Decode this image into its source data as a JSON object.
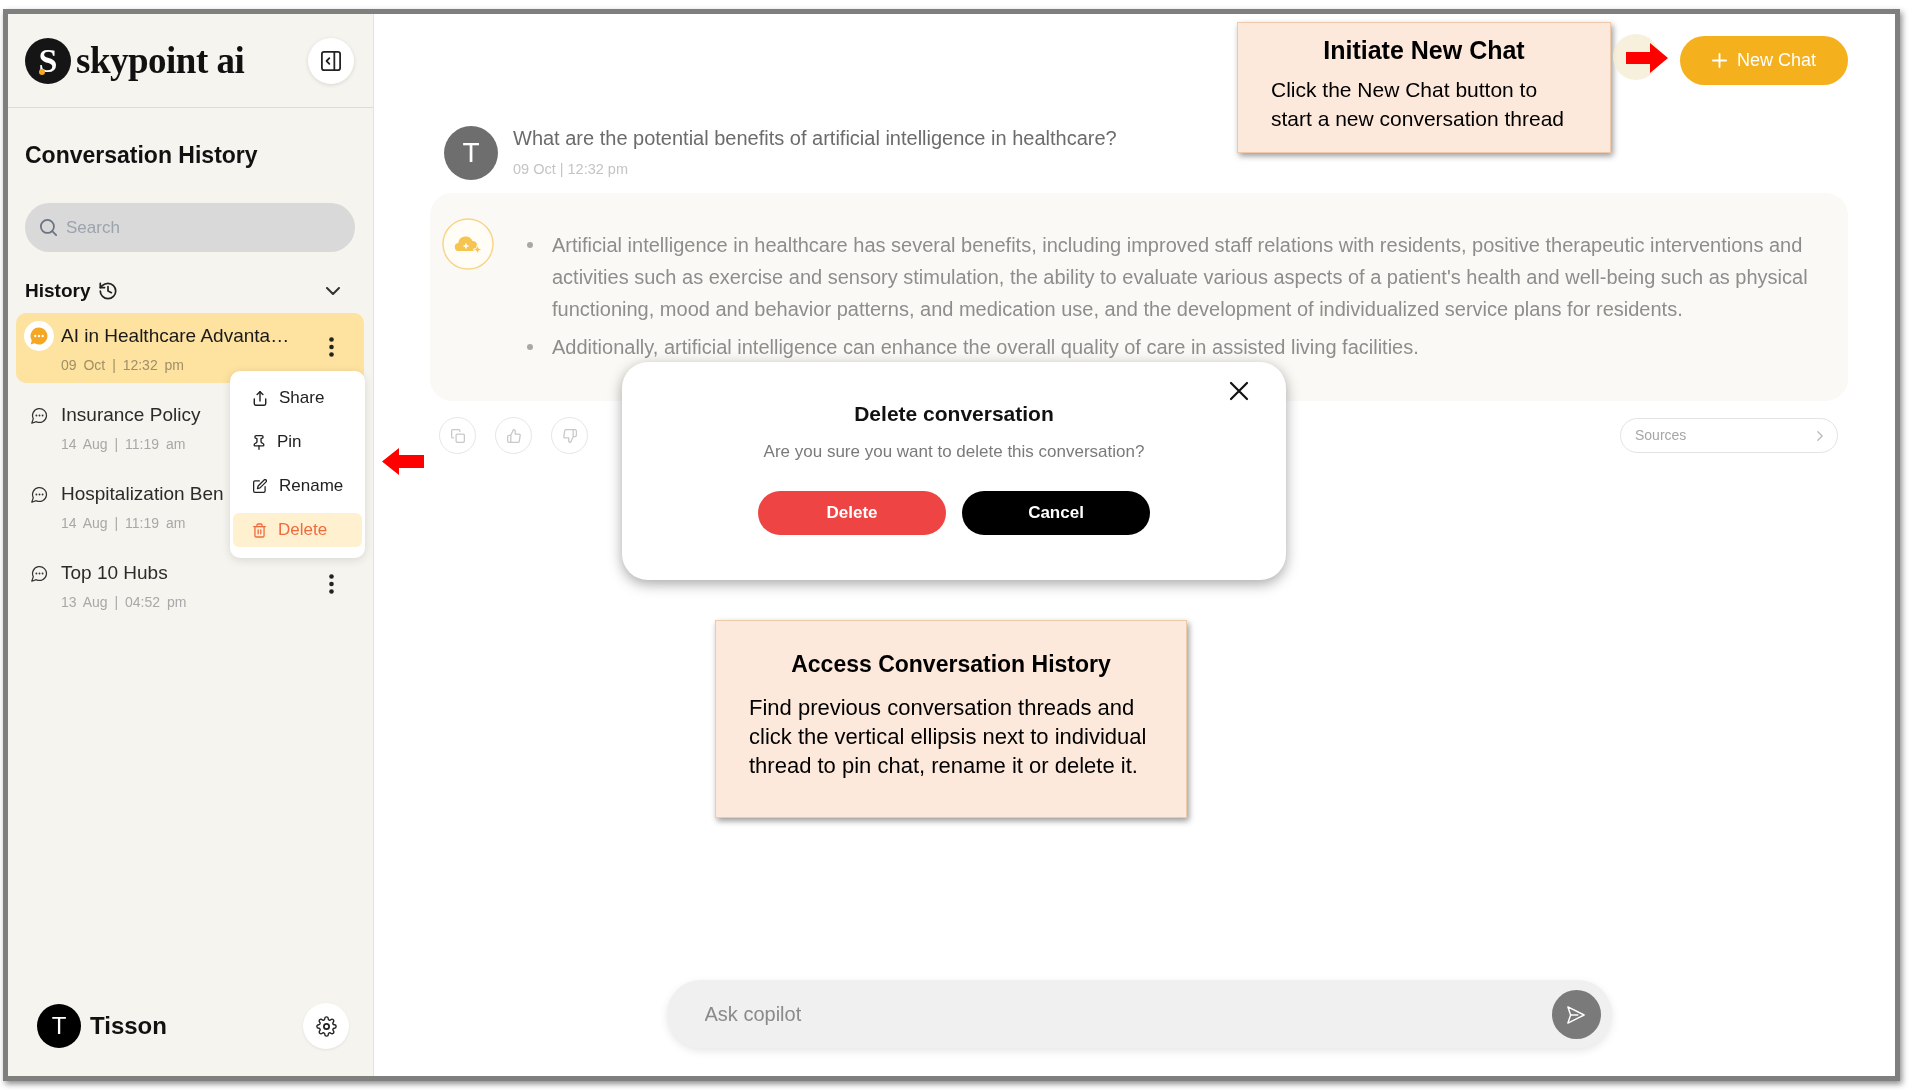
{
  "sidebar": {
    "logo": {
      "mark": "S",
      "text": "skypoint ai"
    },
    "title": "Conversation History",
    "search": {
      "placeholder": "Search"
    },
    "history": {
      "label": "History",
      "expanded": true
    },
    "conversations": [
      {
        "title": "AI in Healthcare Advanta…",
        "time": "09 Oct | 12:32 pm",
        "selected": true,
        "menu_button": true
      },
      {
        "title": "Insurance Policy",
        "time": "14 Aug | 11:19 am",
        "selected": false,
        "menu_button": false
      },
      {
        "title": "Hospitalization Ben",
        "time": "14 Aug | 11:19 am",
        "selected": false,
        "menu_button": false
      },
      {
        "title": "Top 10 Hubs",
        "time": "13 Aug | 04:52 pm",
        "selected": false,
        "menu_button": true
      }
    ],
    "context_menu": [
      {
        "label": "Share",
        "selected": false
      },
      {
        "label": "Pin",
        "selected": false
      },
      {
        "label": "Rename",
        "selected": false
      },
      {
        "label": "Delete",
        "selected": true
      }
    ],
    "user": {
      "initial": "T",
      "name": "Tisson"
    }
  },
  "header": {
    "new_chat_button": "New Chat"
  },
  "conversation": {
    "question": {
      "avatar": "T",
      "text": "What are the potential benefits of artificial intelligence in healthcare?",
      "time": "09 Oct | 12:32 pm"
    },
    "answer": {
      "bullets": [
        "Artificial intelligence in healthcare has several benefits, including improved staff relations with residents, positive therapeutic interventions and activities such as exercise and sensory stimulation, the ability to evaluate various aspects of a patient's health and well-being such as physical functioning, mood and behavior patterns, and medication use, and the development of individualized service plans for residents.",
        "Additionally, artificial intelligence can enhance the overall quality of care in assisted living facilities."
      ]
    },
    "sources_button": "Sources"
  },
  "composer": {
    "placeholder": "Ask copilot"
  },
  "dialog": {
    "title": "Delete conversation",
    "message": "Are you sure you want to delete this conversation?",
    "buttons": [
      {
        "label": "Delete",
        "kind": "danger"
      },
      {
        "label": "Cancel",
        "kind": "dismiss"
      }
    ]
  },
  "callouts": [
    {
      "title": "Initiate New Chat",
      "text": "Click the New Chat button to start a new conversation thread"
    },
    {
      "title": "Access Conversation History",
      "text": "Find previous conversation threads and click the vertical ellipsis next to individual thread to pin chat, rename it or delete it."
    }
  ]
}
